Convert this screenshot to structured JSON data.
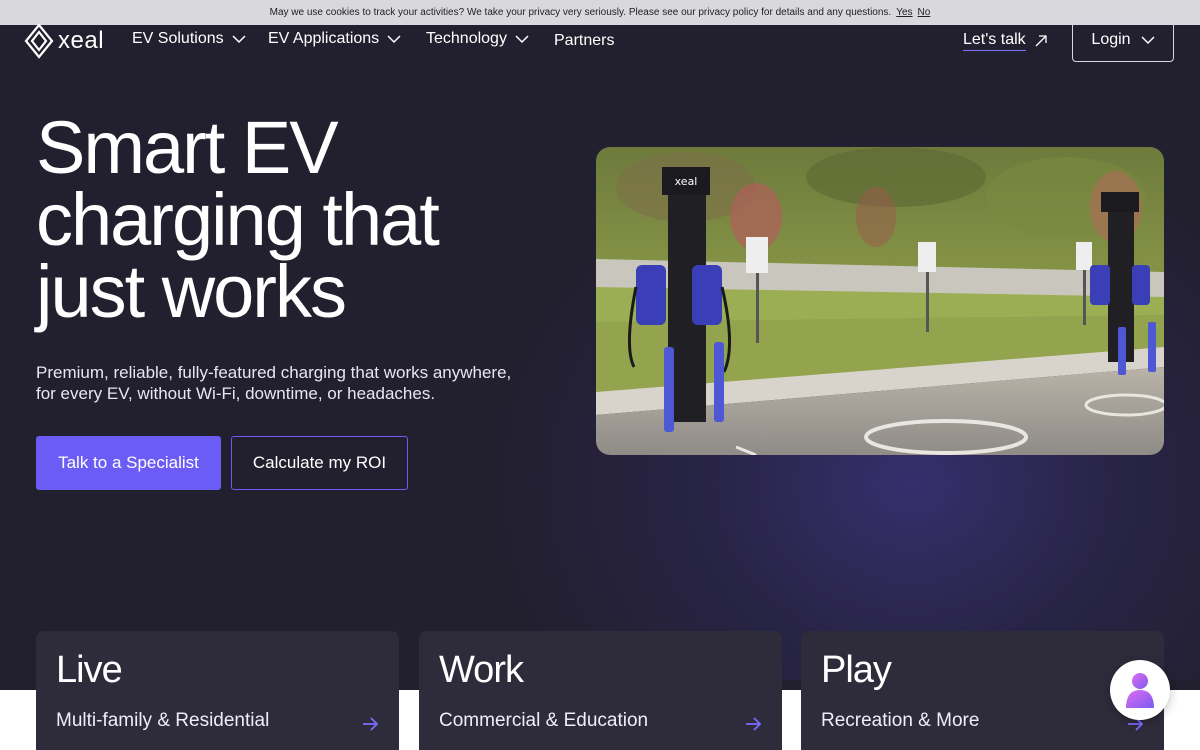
{
  "cookie": {
    "text": "May we use cookies to track your activities? We take your privacy very seriously. Please see our privacy policy for details and any questions.",
    "yes": "Yes",
    "no": "No"
  },
  "nav": {
    "logo_text": "xeal",
    "items": [
      {
        "label": "EV Solutions",
        "has_dropdown": true
      },
      {
        "label": "EV Applications",
        "has_dropdown": true
      },
      {
        "label": "Technology",
        "has_dropdown": true
      },
      {
        "label": "Partners",
        "has_dropdown": false
      }
    ],
    "lets_talk": "Let's talk",
    "login": "Login"
  },
  "hero": {
    "title_line1": "Smart EV",
    "title_line2": "charging that",
    "title_line3": "just works",
    "subtitle_line1": "Premium, reliable, fully-featured charging that works anywhere,",
    "subtitle_line2": "for every EV, without Wi-Fi, downtime, or headaches.",
    "primary_cta": "Talk to a Specialist",
    "secondary_cta": "Calculate my ROI",
    "image_charger_brand": "xeal"
  },
  "cards": [
    {
      "title": "Live",
      "subtitle": "Multi-family & Residential"
    },
    {
      "title": "Work",
      "subtitle": "Commercial & Education"
    },
    {
      "title": "Play",
      "subtitle": "Recreation & More"
    }
  ],
  "colors": {
    "background": "#221f2e",
    "accent": "#6b5cf6",
    "card": "#2e2b3b",
    "cookie_bar": "#d9d9dd"
  },
  "icons": [
    "xeal-logo-icon",
    "chevron-down-icon",
    "arrow-up-right-icon",
    "arrow-right-icon",
    "chat-avatar-icon"
  ]
}
